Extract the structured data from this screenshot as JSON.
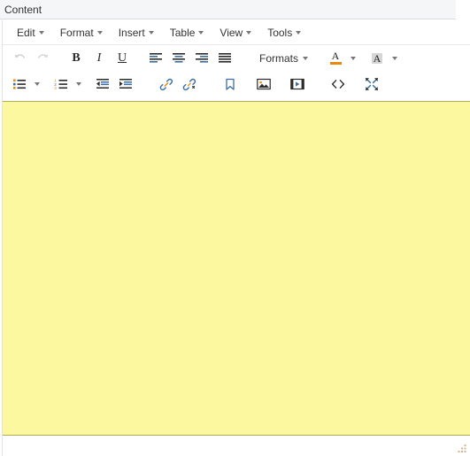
{
  "field": {
    "label": "Content"
  },
  "menubar": {
    "items": [
      {
        "label": "Edit",
        "name": "menu-edit"
      },
      {
        "label": "Format",
        "name": "menu-format"
      },
      {
        "label": "Insert",
        "name": "menu-insert"
      },
      {
        "label": "Table",
        "name": "menu-table"
      },
      {
        "label": "View",
        "name": "menu-view"
      },
      {
        "label": "Tools",
        "name": "menu-tools"
      }
    ]
  },
  "toolbar_row1": {
    "undo_title": "Undo",
    "redo_title": "Redo",
    "bold_glyph": "B",
    "italic_glyph": "I",
    "underline_glyph": "U",
    "align_left_title": "Align left",
    "align_center_title": "Align center",
    "align_right_title": "Align right",
    "align_justify_title": "Justify",
    "formats_label": "Formats",
    "forecolor_letter": "A",
    "backcolor_letter": "A",
    "forecolor_swatch": "#e8890c",
    "backcolor_swatch": "#d6d6d6"
  },
  "toolbar_row2": {
    "bullist_title": "Bullet list",
    "numlist_title": "Numbered list",
    "outdent_title": "Decrease indent",
    "indent_title": "Increase indent",
    "link_title": "Insert/edit link",
    "unlink_title": "Remove link",
    "anchor_title": "Anchor",
    "image_title": "Insert/edit image",
    "media_title": "Insert/edit media",
    "sourcecode_label": "<>",
    "fullscreen_title": "Fullscreen"
  },
  "editor_body": {
    "text": "",
    "background_color": "#fcf8a0",
    "border_color": "#b5ad56"
  },
  "colors": {
    "top_strip": "#f5f6f7",
    "border": "#d9dde3",
    "text": "#333333",
    "icon": "#2b2b2b",
    "icon_blue": "#3b6ea5",
    "icon_orange": "#e8890c"
  }
}
